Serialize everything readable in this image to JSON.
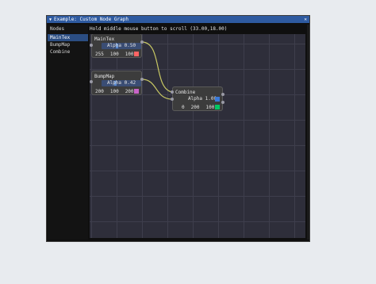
{
  "window": {
    "title": "Example: Custom Node Graph",
    "collapse_icon": "triangle-down-icon",
    "close_icon": "close-icon"
  },
  "left_panel": {
    "header": "Nodes",
    "items": [
      {
        "label": "MainTex",
        "selected": true
      },
      {
        "label": "BumpMap",
        "selected": false
      },
      {
        "label": "Combine",
        "selected": false
      }
    ]
  },
  "hint": "Hold middle mouse button to scroll (33.00,18.00)",
  "nodes": {
    "maintex": {
      "title": "MainTex",
      "alpha": "Alpha 0.50",
      "alpha_value": 0.5,
      "r": "255",
      "g": "100",
      "b": "100",
      "color": "#ff6464"
    },
    "bumpmap": {
      "title": "BumpMap",
      "alpha": "Alpha 0.42",
      "alpha_value": 0.42,
      "r": "200",
      "g": "100",
      "b": "200",
      "color": "#c864c8"
    },
    "combine": {
      "title": "Combine",
      "alpha": "Alpha 1.00",
      "alpha_value": 1.0,
      "alpha_color": "#3a7ad8",
      "r": "0",
      "g": "200",
      "b": "100",
      "color": "#00c864"
    }
  },
  "colors": {
    "link": "#c8c864",
    "selection": "#2b4d82",
    "titlebar": "#2e5aa0"
  }
}
